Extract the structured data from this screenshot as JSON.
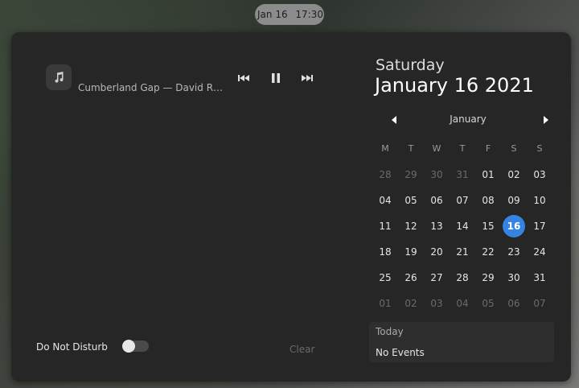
{
  "topbar": {
    "date": "Jan 16",
    "time": "17:30"
  },
  "media": {
    "icon": "music-note-icon",
    "title": "Cumberland Gap — David R…",
    "controls": [
      "previous-icon",
      "pause-icon",
      "next-icon"
    ]
  },
  "notifications": {
    "dnd_label": "Do Not Disturb",
    "dnd_enabled": false,
    "clear_label": "Clear"
  },
  "calendar": {
    "day_name": "Saturday",
    "full_date": "January 16 2021",
    "month": "January",
    "weekdays": [
      "M",
      "T",
      "W",
      "T",
      "F",
      "S",
      "S"
    ],
    "weeks": [
      [
        {
          "t": "28",
          "o": true
        },
        {
          "t": "29",
          "o": true
        },
        {
          "t": "30",
          "o": true
        },
        {
          "t": "31",
          "o": true
        },
        {
          "t": "01"
        },
        {
          "t": "02"
        },
        {
          "t": "03"
        }
      ],
      [
        {
          "t": "04"
        },
        {
          "t": "05"
        },
        {
          "t": "06"
        },
        {
          "t": "07"
        },
        {
          "t": "08"
        },
        {
          "t": "09"
        },
        {
          "t": "10"
        }
      ],
      [
        {
          "t": "11"
        },
        {
          "t": "12"
        },
        {
          "t": "13"
        },
        {
          "t": "14"
        },
        {
          "t": "15"
        },
        {
          "t": "16",
          "today": true
        },
        {
          "t": "17"
        }
      ],
      [
        {
          "t": "18"
        },
        {
          "t": "19"
        },
        {
          "t": "20"
        },
        {
          "t": "21"
        },
        {
          "t": "22"
        },
        {
          "t": "23"
        },
        {
          "t": "24"
        }
      ],
      [
        {
          "t": "25"
        },
        {
          "t": "26"
        },
        {
          "t": "27"
        },
        {
          "t": "28"
        },
        {
          "t": "29"
        },
        {
          "t": "30"
        },
        {
          "t": "31"
        }
      ],
      [
        {
          "t": "01",
          "o": true
        },
        {
          "t": "02",
          "o": true
        },
        {
          "t": "03",
          "o": true
        },
        {
          "t": "04",
          "o": true
        },
        {
          "t": "05",
          "o": true
        },
        {
          "t": "06",
          "o": true
        },
        {
          "t": "07",
          "o": true
        }
      ]
    ],
    "accent_color": "#3584e4"
  },
  "events": {
    "title": "Today",
    "text": "No Events"
  }
}
